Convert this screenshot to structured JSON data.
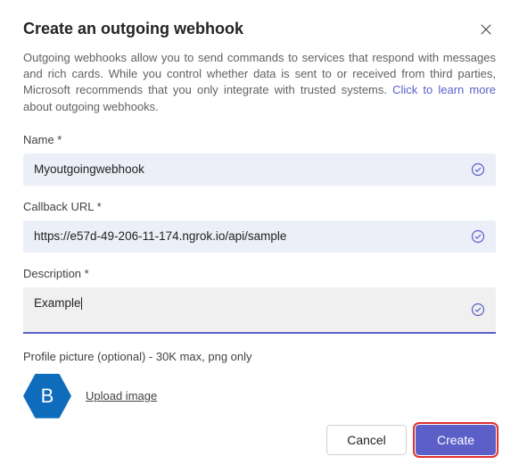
{
  "dialog": {
    "title": "Create an outgoing webhook",
    "description_part1": "Outgoing webhooks allow you to send commands to services that respond with messages and rich cards. While you control whether data is sent to or received from third parties, Microsoft recommends that you only integrate with trusted systems. ",
    "learn_link": "Click to learn more",
    "description_part2": " about outgoing webhooks."
  },
  "fields": {
    "name": {
      "label": "Name *",
      "value": "Myoutgoingwebhook"
    },
    "callback": {
      "label": "Callback URL *",
      "value": "https://e57d-49-206-11-174.ngrok.io/api/sample"
    },
    "description": {
      "label": "Description *",
      "value": "Example"
    }
  },
  "picture": {
    "label": "Profile picture (optional) - 30K max, png only",
    "avatar_letter": "B",
    "upload_text": "Upload image"
  },
  "buttons": {
    "cancel": "Cancel",
    "create": "Create"
  }
}
